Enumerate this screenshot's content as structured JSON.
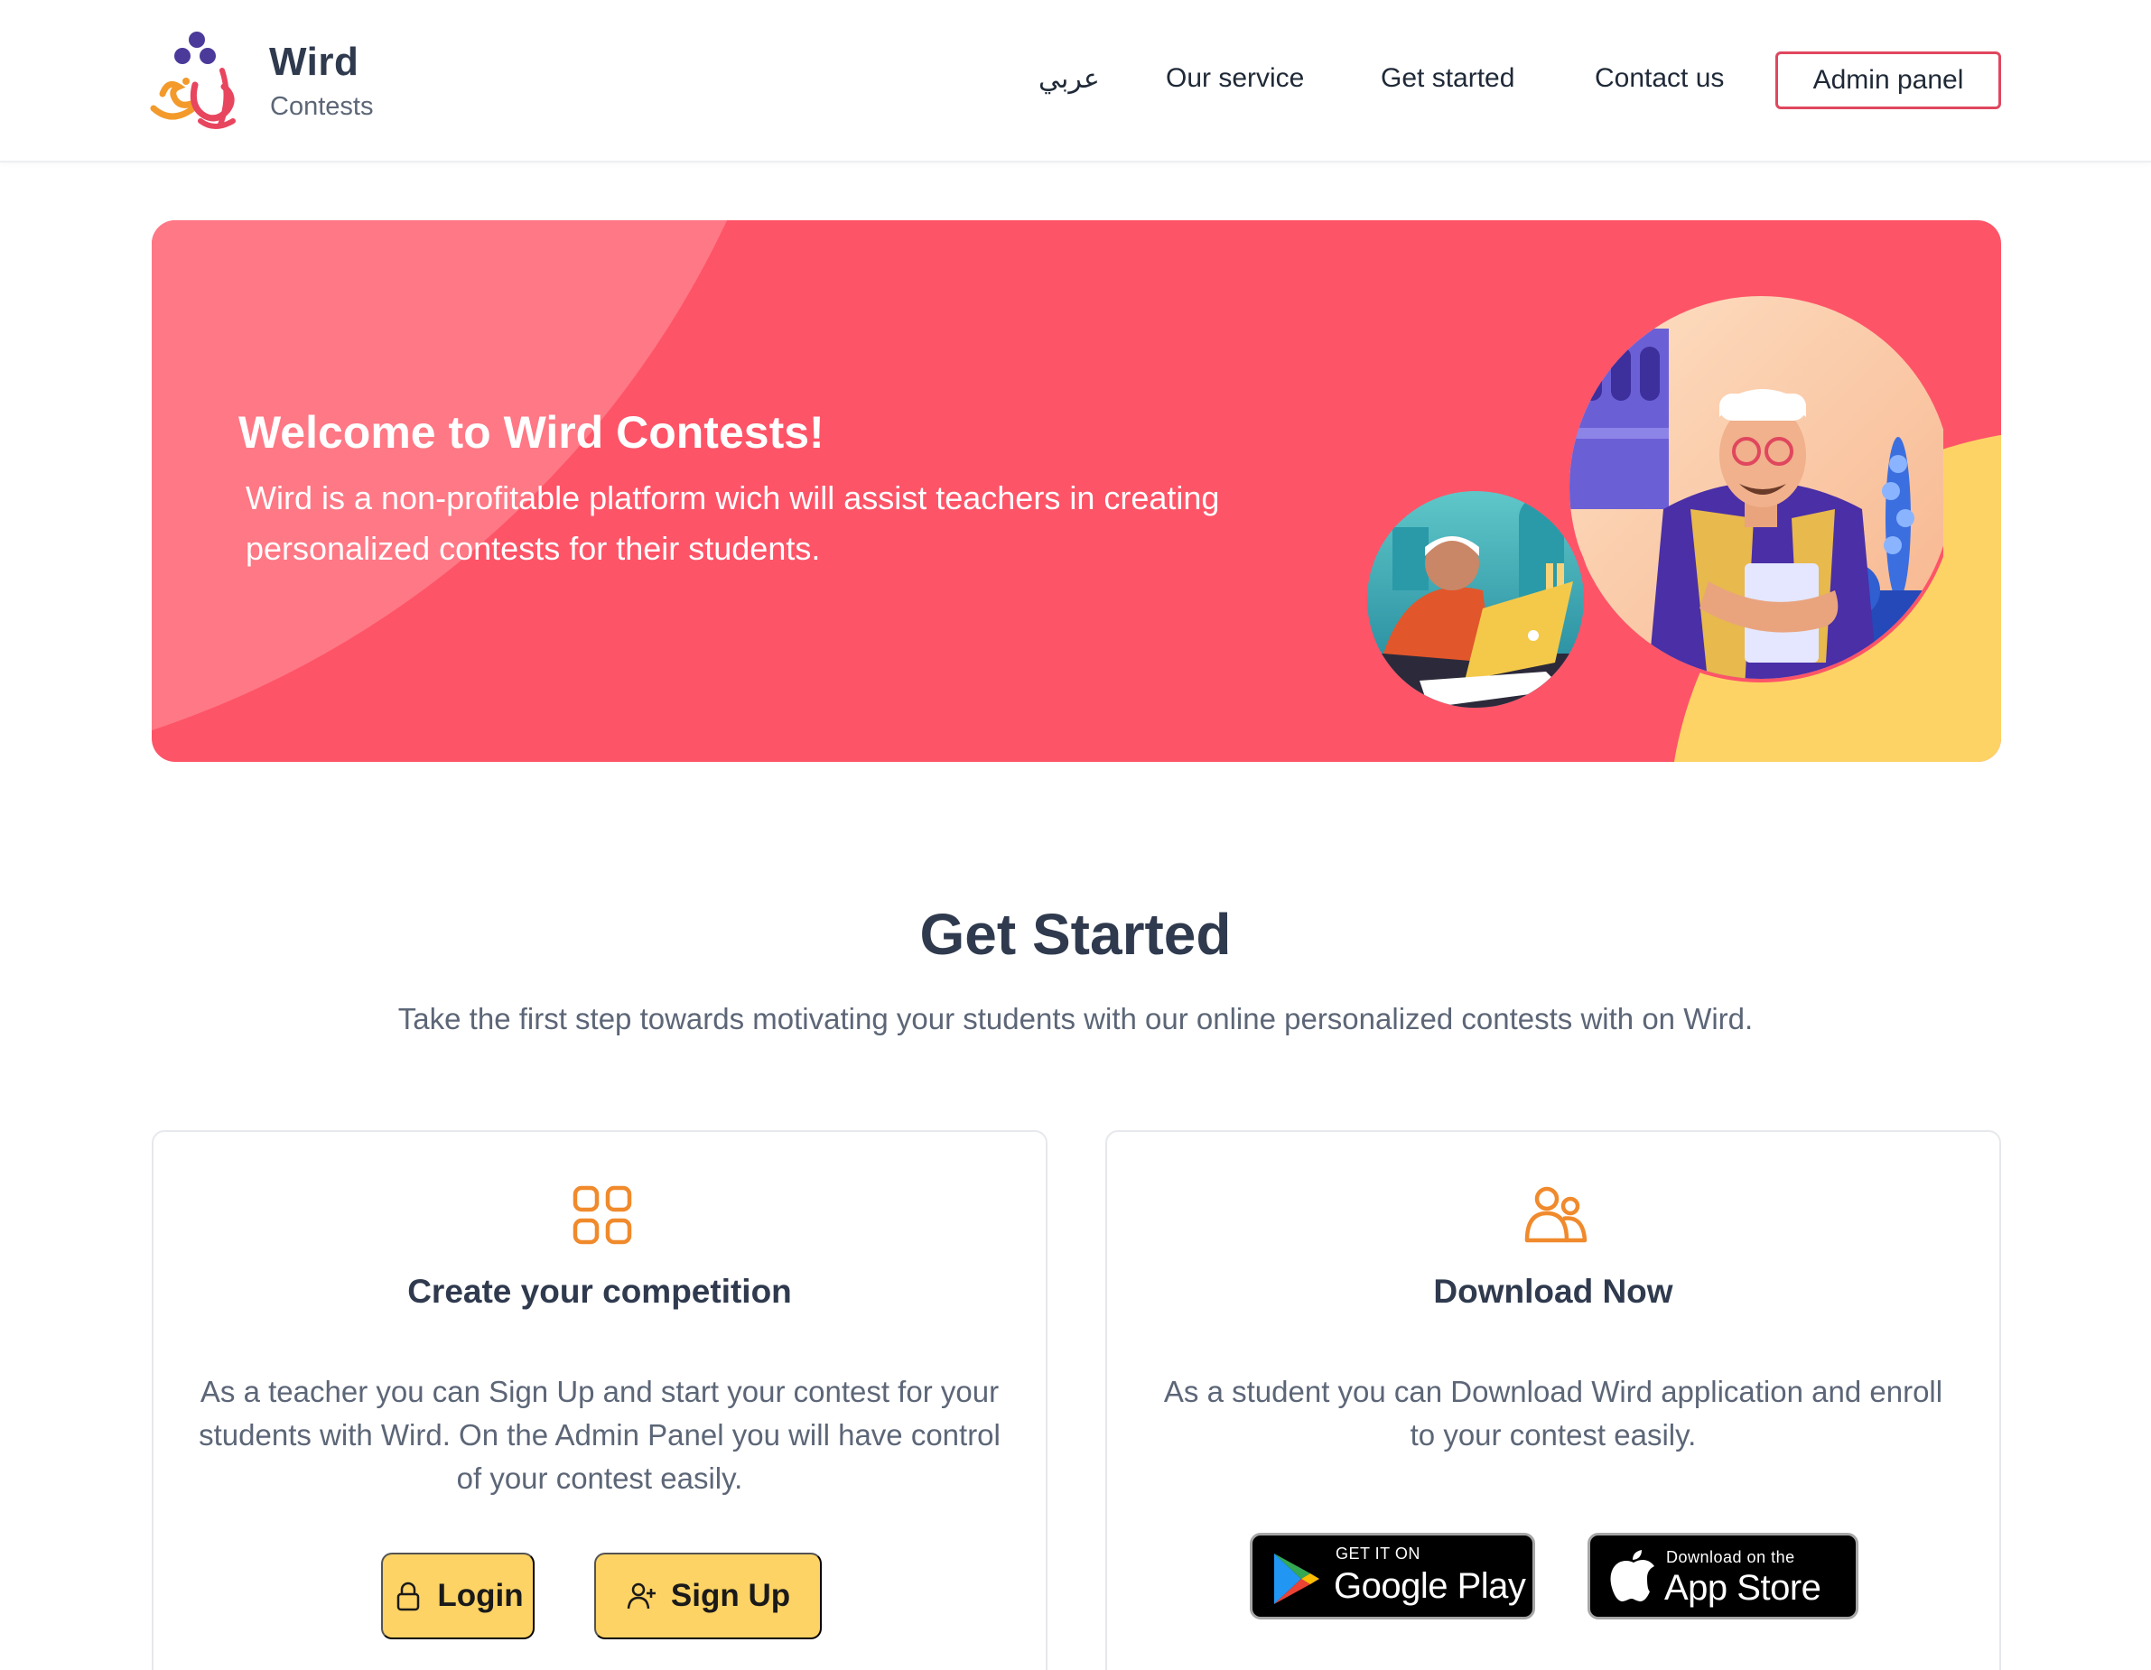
{
  "header": {
    "brand_name": "Wird",
    "brand_sub": "Contests",
    "nav": {
      "arabic": "عربي",
      "service": "Our service",
      "get_started": "Get started",
      "contact": "Contact us",
      "admin": "Admin panel"
    },
    "colors": {
      "accent": "#e0475e",
      "logo_purple": "#4b3a9a",
      "logo_orange": "#f39a2b"
    }
  },
  "hero": {
    "title": "Welcome to Wird Contests!",
    "text": "Wird is a non-profitable platform wich will assist teachers in creating personalized contests for their students.",
    "colors": {
      "background": "#fe5468",
      "light": "#ff7885",
      "yellow": "#fdd365"
    }
  },
  "get_started": {
    "title": "Get Started",
    "subtitle": "Take the first step towards motivating your students with our online personalized contests with on Wird.",
    "cards": [
      {
        "icon": "grid-icon",
        "title": "Create your competition",
        "text": "As a teacher you can Sign Up and start your contest for your students with Wird. On the Admin Panel you will have control of your contest easily.",
        "buttons": [
          {
            "icon": "lock-icon",
            "label": "Login"
          },
          {
            "icon": "user-plus-icon",
            "label": "Sign Up"
          }
        ]
      },
      {
        "icon": "users-icon",
        "title": "Download Now",
        "text": "As a student you can Download Wird application and enroll to your contest easily.",
        "stores": [
          {
            "icon": "google-play-icon",
            "small": "GET IT ON",
            "big": "Google Play"
          },
          {
            "icon": "apple-icon",
            "small": "Download on the",
            "big": "App Store"
          }
        ]
      }
    ],
    "colors": {
      "icon": "#f08a2c",
      "button": "#fdd365"
    }
  }
}
